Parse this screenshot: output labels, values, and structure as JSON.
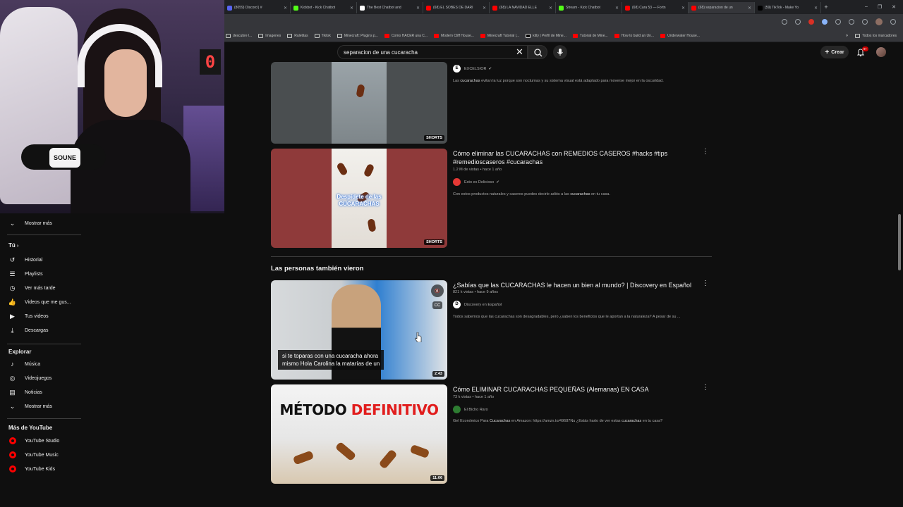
{
  "browser": {
    "tabs": [
      {
        "title": "(8059) Discord | #",
        "color": "#5865f2"
      },
      {
        "title": "Kickbot - Kick Chatbot",
        "color": "#53fc18"
      },
      {
        "title": "The Best Chatbot and",
        "color": "#ffffff"
      },
      {
        "title": "(68) EL SOBES DE DARI",
        "color": "#ff0000"
      },
      {
        "title": "(68) LA NAVIDAD ELLE",
        "color": "#ff0000"
      },
      {
        "title": "Stream - Kick Chatbot",
        "color": "#53fc18"
      },
      {
        "title": "(68) Cara 53 — Fortn",
        "color": "#ff0000"
      },
      {
        "title": "(68) separacion de un",
        "color": "#ff0000",
        "active": true
      },
      {
        "title": "(59) TikTok - Make Yo",
        "color": "#000000"
      }
    ],
    "new_tab": "+",
    "window_controls": [
      "–",
      "❐",
      "✕"
    ],
    "bookmarks": [
      {
        "label": "descubre l...",
        "type": "folder"
      },
      {
        "label": "Imagenes",
        "type": "folder"
      },
      {
        "label": "Ruletitas",
        "type": "folder"
      },
      {
        "label": "Tiktok",
        "type": "folder"
      },
      {
        "label": "Minecraft: Plugins p...",
        "type": "folder"
      },
      {
        "label": "Como HACER una C...",
        "type": "yt"
      },
      {
        "label": "Modern Cliff House...",
        "type": "yt"
      },
      {
        "label": "Minecraft Tutorial |...",
        "type": "yt"
      },
      {
        "label": "kitty | Perfil de Mine...",
        "type": "tk"
      },
      {
        "label": "Tutorial de Mine...",
        "type": "yt"
      },
      {
        "label": "How to build an Un...",
        "type": "yt"
      },
      {
        "label": "Underwater House...",
        "type": "yt"
      }
    ],
    "bookmarks_more": "»",
    "all_bookmarks": "Todos los marcadores"
  },
  "webcam": {
    "sign_text": "0",
    "mic_band": "SOUNE"
  },
  "header": {
    "search_value": "separacion de una cucaracha",
    "clear_icon": "✕",
    "search_icon": "⌕",
    "mic_icon": "🎙",
    "create_label": "Crear",
    "create_icon": "+",
    "notif_count": "9+"
  },
  "sidebar": {
    "show_more_1": "Mostrar más",
    "you_header": "Tú",
    "you_items": [
      {
        "label": "Historial",
        "icon": "history-icon"
      },
      {
        "label": "Playlists",
        "icon": "playlist-icon"
      },
      {
        "label": "Ver más tarde",
        "icon": "clock-icon"
      },
      {
        "label": "Videos que me gus...",
        "icon": "thumbs-up-icon"
      },
      {
        "label": "Tus videos",
        "icon": "your-videos-icon"
      },
      {
        "label": "Descargas",
        "icon": "download-icon"
      }
    ],
    "explore_header": "Explorar",
    "explore_items": [
      {
        "label": "Música",
        "icon": "music-icon"
      },
      {
        "label": "Videojuegos",
        "icon": "gaming-icon"
      },
      {
        "label": "Noticias",
        "icon": "news-icon"
      }
    ],
    "show_more_2": "Mostrar más",
    "more_header": "Más de YouTube",
    "more_items": [
      {
        "label": "YouTube Studio"
      },
      {
        "label": "YouTube Music"
      },
      {
        "label": "YouTube Kids"
      }
    ]
  },
  "results": [
    {
      "channel": "EXCELSIOR",
      "verified": true,
      "desc_prefix": "Las ",
      "desc_bold": "cucarachas",
      "desc_suffix": " evitan la luz porque son nocturnas y su sistema visual está adaptado para moverse mejor en la oscuridad.",
      "badge": "SHORTS"
    },
    {
      "title_line1": "Cómo eliminar las CUCARACHAS con REMEDIOS CASEROS #hacks #tips",
      "title_line2": "#remedioscaseros #cucarachas",
      "meta": "1.2 M de vistas • hace 1 año",
      "channel": "Esto es Delicioso",
      "verified": true,
      "desc_prefix": "Con estos productos naturales y caseros puedes decirle adiós a las ",
      "desc_bold": "cucarachas",
      "desc_suffix": " en tu casa.",
      "badge": "SHORTS",
      "overlay_line1": "Despídete de las",
      "overlay_line2": "CUCARACHAS"
    }
  ],
  "section_title": "Las personas también vieron",
  "related": [
    {
      "title": "¿Sabías que las CUCARACHAS le hacen un bien al mundo? | Discovery en Español",
      "meta": "821 k vistas • hace 9 años",
      "channel": "Discovery en Español",
      "desc": "Todos sabemos que las cucarachas son desagradables, pero ¿saben los beneficios que le aportan a la naturaleza? A pesar de su ...",
      "duration": "2:43",
      "caption_line1": "si te toparas con una cucaracha ahora",
      "caption_line2": "mismo Hola Carolina la matarías de un"
    },
    {
      "title": "Cómo ELIMINAR CUCARACHAS PEQUEÑAS (Alemanas) EN CASA",
      "meta": "73 k vistas • hace 1 año",
      "channel": "El Bicho Raro",
      "desc_prefix": "Gel Económico Para ",
      "desc_bold": "Cucarachas",
      "desc_mid": " en Amazon: https://amzn.to/49687Nu ¿Estás harto de ver estas ",
      "desc_bold2": "cucarachas",
      "desc_suffix": " en tu casa?",
      "duration": "11:06",
      "thumb_word1": "MÉTODO",
      "thumb_word2": "DEFINITIVO"
    }
  ],
  "kebab": "⋮"
}
